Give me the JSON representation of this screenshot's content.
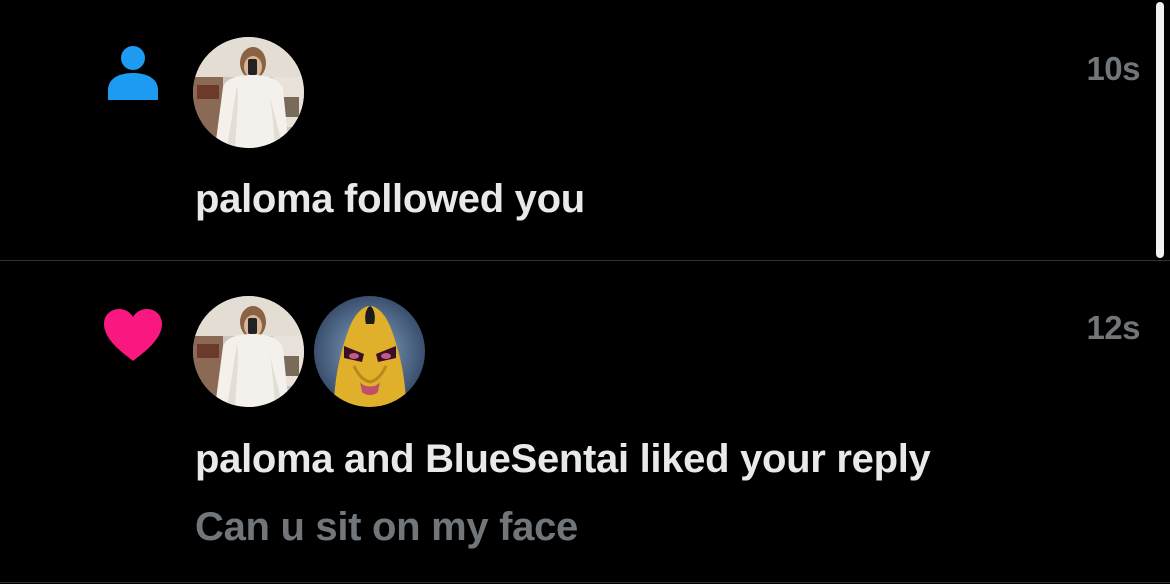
{
  "colors": {
    "background": "#000000",
    "primary_text": "#e7e9ea",
    "secondary_text": "#71767b",
    "follow_icon": "#1d9bf0",
    "like_icon": "#f91880",
    "divider": "#2f3336"
  },
  "notifications": [
    {
      "type": "follow",
      "icon": "person-icon",
      "avatars": [
        "paloma-avatar"
      ],
      "timestamp": "10s",
      "message": "paloma followed you"
    },
    {
      "type": "like",
      "icon": "heart-icon",
      "avatars": [
        "paloma-avatar",
        "bluesentai-avatar"
      ],
      "timestamp": "12s",
      "message": "paloma and BlueSentai liked your reply",
      "reply_text": "Can u sit on my face"
    }
  ]
}
